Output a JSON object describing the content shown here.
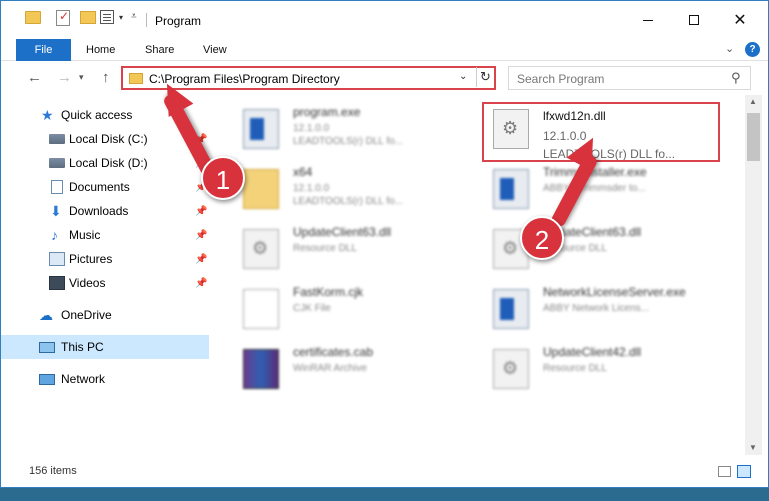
{
  "window": {
    "title": "Program",
    "controls": {
      "minimize": "—",
      "maximize": "☐",
      "close": "✕"
    }
  },
  "ribbon": {
    "tabs": [
      {
        "label": "File",
        "active": true
      },
      {
        "label": "Home"
      },
      {
        "label": "Share"
      },
      {
        "label": "View"
      }
    ],
    "help": "?"
  },
  "navigation": {
    "address": "C:\\Program Files\\Program Directory",
    "search_placeholder": "Search Program"
  },
  "sidebar": {
    "items": [
      {
        "label": "Quick access"
      },
      {
        "label": "Local Disk (C:)"
      },
      {
        "label": "Local Disk (D:)"
      },
      {
        "label": "Documents"
      },
      {
        "label": "Downloads"
      },
      {
        "label": "Music"
      },
      {
        "label": "Pictures"
      },
      {
        "label": "Videos"
      },
      {
        "label": "OneDrive"
      },
      {
        "label": "This PC",
        "selected": true
      },
      {
        "label": "Network"
      }
    ]
  },
  "files": [
    {
      "name": "program.exe",
      "line1": "12.1.0.0",
      "line2": "LEADTOOLS(r) DLL fo...",
      "icon": "exe-icon"
    },
    {
      "name": "lfxwd12n.dll",
      "line1": "12.1.0.0",
      "line2": "LEADTOOLS(r) DLL fo...",
      "icon": "dll-icon",
      "highlighted": true
    },
    {
      "name": "x64",
      "line1": "12.1.0.0",
      "line2": "LEADTOOLS(r) DLL fo...",
      "icon": "folder-icon"
    },
    {
      "name": "TrimmsInstaller.exe",
      "line1": "ABBYY Trimmsder to...",
      "line2": "",
      "icon": "exe-icon"
    },
    {
      "name": "UpdateClient63.dll",
      "line1": "Resource DLL",
      "line2": "",
      "icon": "dll-icon"
    },
    {
      "name": "UpdateClient63.dll",
      "line1": "Resource DLL",
      "line2": "",
      "icon": "dll-icon"
    },
    {
      "name": "FastKorm.cjk",
      "line1": "CJK File",
      "line2": "",
      "icon": "file-icon"
    },
    {
      "name": "NetworkLicenseServer.exe",
      "line1": "ABBY Network Licens...",
      "line2": "",
      "icon": "exe-icon"
    },
    {
      "name": "certificates.cab",
      "line1": "WinRAR Archive",
      "line2": "",
      "icon": "archive-icon"
    },
    {
      "name": "UpdateClient42.dll",
      "line1": "Resource DLL",
      "line2": "",
      "icon": "dll-icon"
    }
  ],
  "status": {
    "item_count": "156 items"
  },
  "annotations": {
    "step1": "1",
    "step2": "2",
    "color": "#d8323c"
  }
}
